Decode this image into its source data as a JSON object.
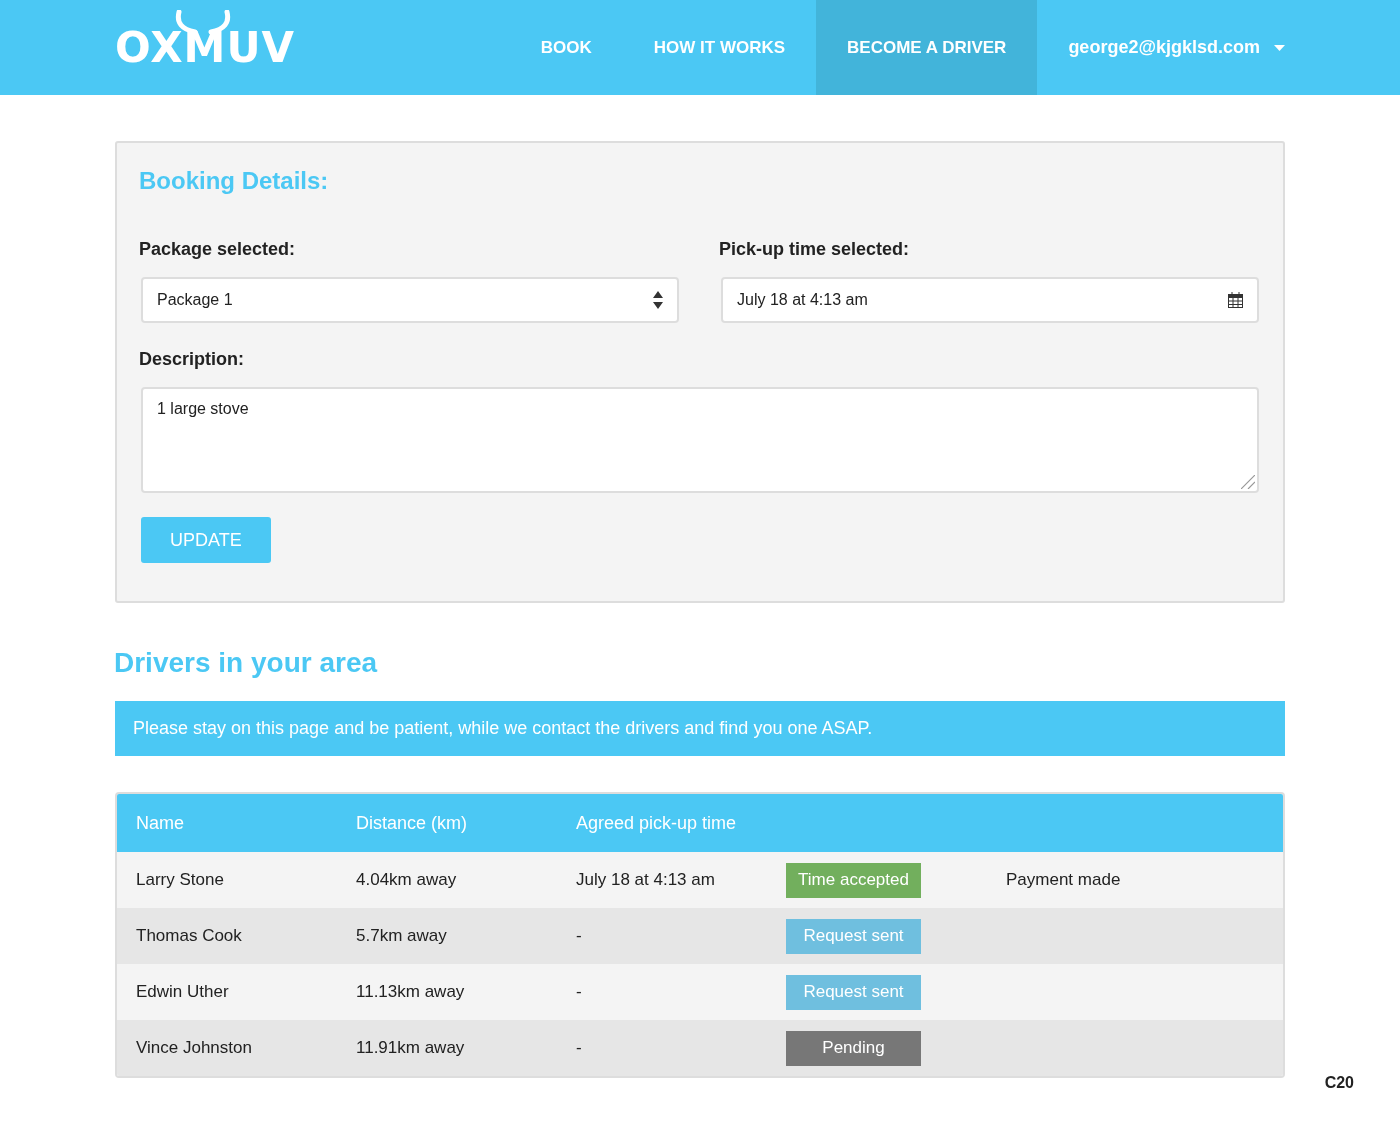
{
  "header": {
    "logo": "OXMUV",
    "nav": [
      {
        "label": "BOOK",
        "selected": false
      },
      {
        "label": "HOW IT WORKS",
        "selected": false
      },
      {
        "label": "BECOME A DRIVER",
        "selected": true
      }
    ],
    "user_menu": "george2@kjgklsd.com"
  },
  "booking": {
    "title": "Booking Details:",
    "package_label": "Package selected:",
    "package_value": "Package 1",
    "time_label": "Pick-up time selected:",
    "time_value": "July 18 at 4:13 am",
    "description_label": "Description:",
    "description_value": "1 large stove",
    "button": "UPDATE"
  },
  "drivers": {
    "title": "Drivers in your area",
    "notice": "Please stay on this page and be patient, while we contact the drivers and find you one ASAP.",
    "columns": [
      "Name",
      "Distance (km)",
      "Agreed pick-up time"
    ],
    "rows": [
      {
        "name": "Larry Stone",
        "distance": "4.04km away",
        "time": "July 18 at 4:13 am",
        "status": {
          "kind": "accepted",
          "label": "Time accepted"
        },
        "payment": "Payment made"
      },
      {
        "name": "Thomas Cook",
        "distance": "5.7km away",
        "time": "-",
        "status": {
          "kind": "sent",
          "label": "Request sent"
        }
      },
      {
        "name": "Edwin Uther",
        "distance": "11.13km away",
        "time": "-",
        "status": {
          "kind": "sent",
          "label": "Request sent"
        }
      },
      {
        "name": "Vince Johnston",
        "distance": "11.91km away",
        "time": "-",
        "status": {
          "kind": "pending",
          "label": "Pending"
        }
      }
    ]
  },
  "page_code": "C20"
}
